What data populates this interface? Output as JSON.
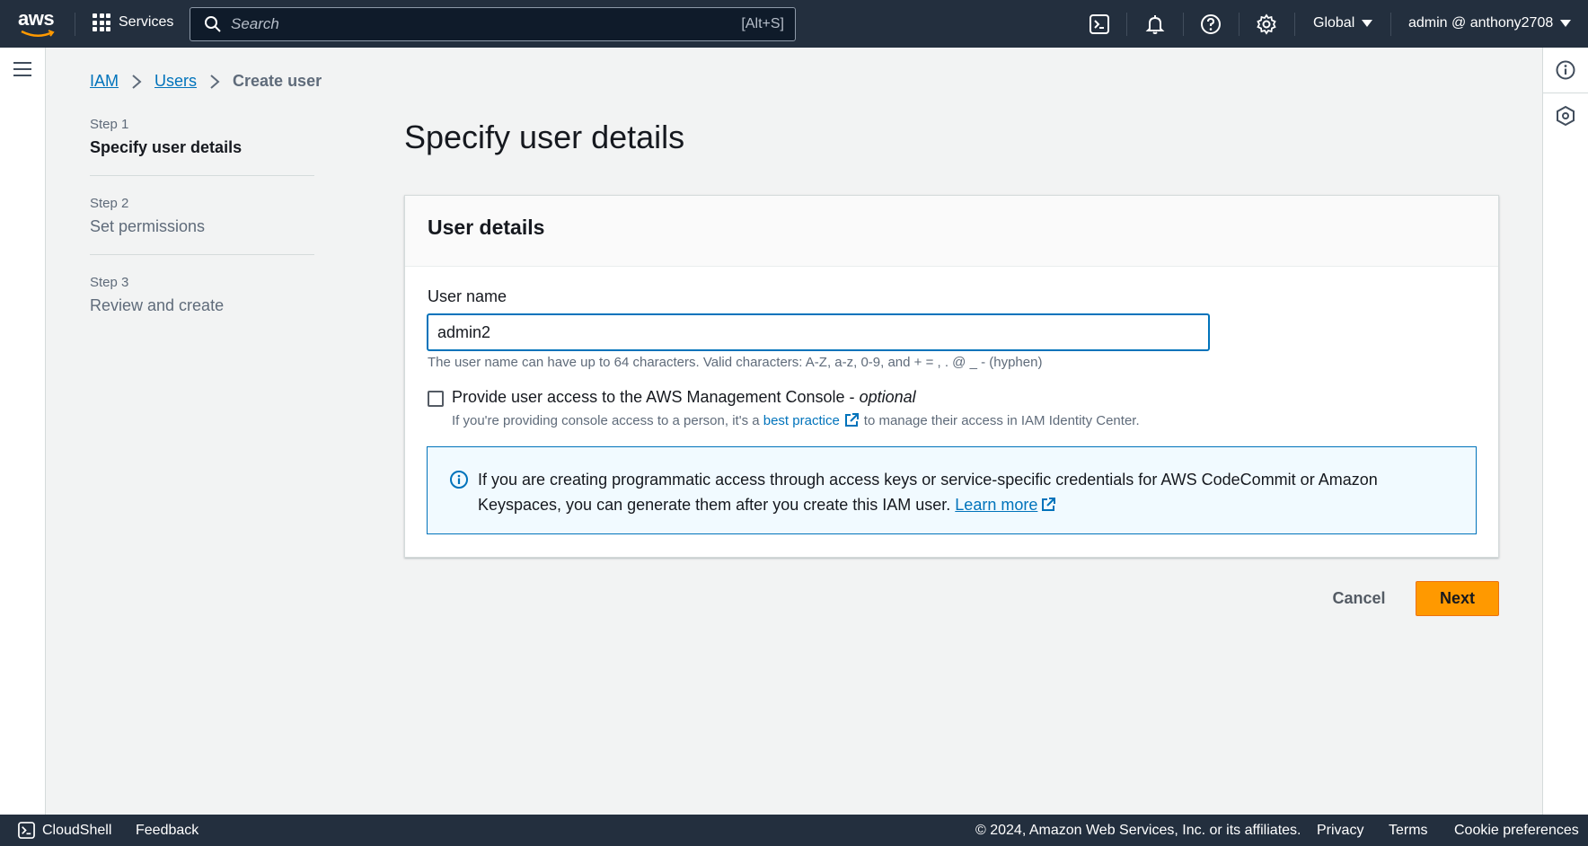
{
  "topnav": {
    "logo_text": "aws",
    "services_label": "Services",
    "search_placeholder": "Search",
    "search_shortcut": "[Alt+S]",
    "region_label": "Global",
    "account_label": "admin @ anthony2708",
    "icons": [
      "cloudshell-icon",
      "notifications-icon",
      "help-icon",
      "settings-icon"
    ]
  },
  "breadcrumb": {
    "items": [
      "IAM",
      "Users"
    ],
    "current": "Create user"
  },
  "steps": [
    {
      "num": "Step 1",
      "title": "Specify user details",
      "active": true
    },
    {
      "num": "Step 2",
      "title": "Set permissions",
      "active": false
    },
    {
      "num": "Step 3",
      "title": "Review and create",
      "active": false
    }
  ],
  "page": {
    "title": "Specify user details"
  },
  "panel": {
    "title": "User details",
    "username_label": "User name",
    "username_value": "admin2",
    "username_constraint": "The user name can have up to 64 characters. Valid characters: A-Z, a-z, 0-9, and + = , . @ _ - (hyphen)",
    "console_access_label": "Provide user access to the AWS Management Console - ",
    "console_access_optional": "optional",
    "console_access_checked": false,
    "console_desc_before": "If you're providing console access to a person, it's a",
    "console_desc_link": "best practice",
    "console_desc_after": "to manage their access in IAM Identity Center.",
    "info_text": "If you are creating programmatic access through access keys or service-specific credentials for AWS CodeCommit or Amazon Keyspaces, you can generate them after you create this IAM user.",
    "info_link": "Learn more"
  },
  "actions": {
    "cancel_label": "Cancel",
    "next_label": "Next"
  },
  "footer": {
    "cloudshell_label": "CloudShell",
    "feedback_label": "Feedback",
    "copyright": "© 2024, Amazon Web Services, Inc. or its affiliates.",
    "privacy_label": "Privacy",
    "terms_label": "Terms",
    "cookie_label": "Cookie preferences"
  },
  "colors": {
    "nav_bg": "#232f3e",
    "link": "#0073bb",
    "primary_button": "#ff9900",
    "info_bg": "#f1faff"
  }
}
